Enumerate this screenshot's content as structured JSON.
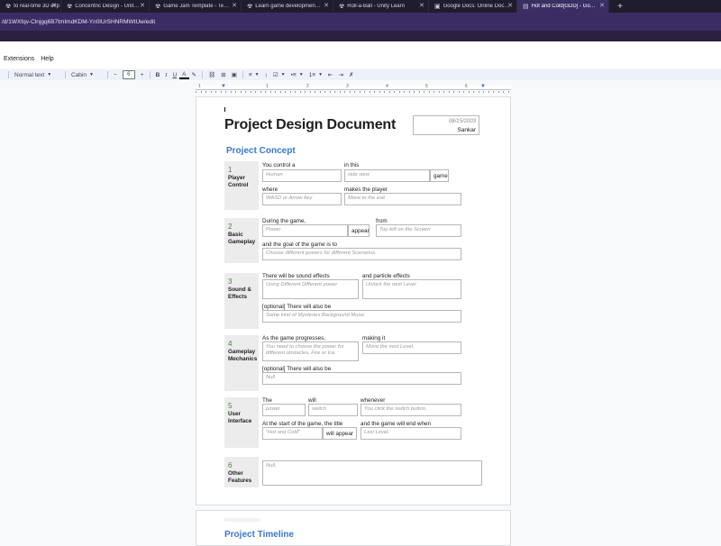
{
  "browser": {
    "tabs": [
      {
        "label": "to real-time 3D exp",
        "icon": "☢",
        "width": 68
      },
      {
        "label": "Concentric Design - Unity Learn",
        "icon": "☢",
        "width": 98
      },
      {
        "label": "Game Jam Template - Tetris",
        "icon": "☢",
        "width": 102
      },
      {
        "label": "Learn game development w/ Un",
        "icon": "☢",
        "width": 102
      },
      {
        "label": "Roll-a-Ball - Unity Learn",
        "icon": "☢",
        "width": 106
      },
      {
        "label": "Google Docs: Online Document",
        "icon": "▣",
        "width": 98
      },
      {
        "label": "Hot and Cold[GDD] - Google",
        "icon": "▤",
        "width": 102
      }
    ],
    "new_tab": "+",
    "close": "✕",
    "url": "/d/1WXfqv-Clnjgq6B7tmImdKDM-Yn0lUrSHNRMWtUw/edit"
  },
  "menu": [
    "Extensions",
    "Help"
  ],
  "toolbar": {
    "style": "Normal text",
    "font": "Cabin",
    "size": "6",
    "minus": "−",
    "plus": "+",
    "bold": "B",
    "italic": "I",
    "underline": "U",
    "text_color": "A",
    "highlight": "✎",
    "link": "⛓",
    "comment": "⊞",
    "image": "▣",
    "align": "≡",
    "line_spacing": "↕",
    "checklist": "☑",
    "bullets": "•≡",
    "numbered": "1≡",
    "indent_less": "⇤",
    "indent_more": "⇥",
    "clear_format": "✗"
  },
  "ruler": {
    "numbers": [
      "1",
      "1",
      "2",
      "3",
      "4",
      "5",
      "6"
    ]
  },
  "doc": {
    "title": "Project Design Document",
    "date": "08/15/2003",
    "author": "Sankar",
    "section_heading": "Project Concept",
    "sections": {
      "player_control": {
        "num": "1",
        "label": "Player Control",
        "you_control_a": "You control a",
        "you_control_value": "Human",
        "in_this": "in this",
        "in_this_value": "side view",
        "game": "game",
        "where": "where",
        "where_value": "WASD or Arrow key",
        "makes_player": "makes the player",
        "makes_player_value": "Move to the exit"
      },
      "basic_gameplay": {
        "num": "2",
        "label": "Basic Gameplay",
        "during": "During the game,",
        "during_value": "Power",
        "appear": "appear",
        "from": "from",
        "from_value": "Top left on the Screen",
        "goal": "and the goal of the game is to",
        "goal_value": "Choose different powers for different Scenarios."
      },
      "sound_effects": {
        "num": "3",
        "label": "Sound & Effects",
        "sound": "There will be sound effects",
        "sound_value": "Using Different Different power",
        "particle": "and particle effects",
        "particle_value": "Unlock the next Level",
        "optional": "[optional] There will also be",
        "optional_value": "Some kind of Mysteries Background Music"
      },
      "gameplay_mechanics": {
        "num": "4",
        "label": "Gameplay Mechanics",
        "progresses": "As the game progresses,",
        "progresses_value": "You need to choose the power for different obstacles, Fire or Ice.",
        "making_it": "making it",
        "making_it_value": "Move the next Level.",
        "optional": "[optional] There will also be",
        "optional_value": "Null"
      },
      "user_interface": {
        "num": "5",
        "label": "User Interface",
        "the": "The",
        "the_value": "power",
        "will": "will",
        "will_value": "switch",
        "whenever": "whenever",
        "whenever_value": "You click the switch button.",
        "start": "At the start of the game, the title",
        "start_value": "\"Hot and Cold\"",
        "will_appear": "will appear",
        "end": "and the game will end when",
        "end_value": "Last Level."
      },
      "other_features": {
        "num": "6",
        "label": "Other Features",
        "value": "Null."
      }
    },
    "page2_heading": "Project Timeline"
  }
}
